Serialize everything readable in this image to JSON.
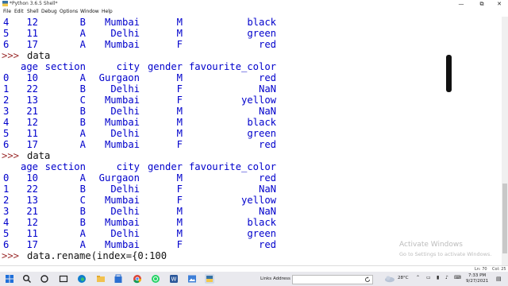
{
  "window": {
    "title": "*Python 3.6.5 Shell*",
    "controls": {
      "minimize": "—",
      "maximize": "⧉",
      "close": "✕"
    }
  },
  "menu": [
    "File",
    "Edit",
    "Shell",
    "Debug",
    "Options",
    "Window",
    "Help"
  ],
  "console": {
    "prompt": ">>>",
    "lines": [
      {
        "kind": "row",
        "cells": [
          "4",
          "12",
          "B",
          "Mumbai",
          "M",
          "black"
        ]
      },
      {
        "kind": "row",
        "cells": [
          "5",
          "11",
          "A",
          "Delhi",
          "M",
          "green"
        ]
      },
      {
        "kind": "row",
        "cells": [
          "6",
          "17",
          "A",
          "Mumbai",
          "F",
          "red"
        ]
      },
      {
        "kind": "cmd",
        "text": "data"
      },
      {
        "kind": "header",
        "cells": [
          "age",
          "section",
          "city",
          "gender",
          "favourite_color"
        ]
      },
      {
        "kind": "row",
        "cells": [
          "0",
          "10",
          "A",
          "Gurgaon",
          "M",
          "red"
        ]
      },
      {
        "kind": "row",
        "cells": [
          "1",
          "22",
          "B",
          "Delhi",
          "F",
          "NaN"
        ]
      },
      {
        "kind": "row",
        "cells": [
          "2",
          "13",
          "C",
          "Mumbai",
          "F",
          "yellow"
        ]
      },
      {
        "kind": "row",
        "cells": [
          "3",
          "21",
          "B",
          "Delhi",
          "M",
          "NaN"
        ]
      },
      {
        "kind": "row",
        "cells": [
          "4",
          "12",
          "B",
          "Mumbai",
          "M",
          "black"
        ]
      },
      {
        "kind": "row",
        "cells": [
          "5",
          "11",
          "A",
          "Delhi",
          "M",
          "green"
        ]
      },
      {
        "kind": "row",
        "cells": [
          "6",
          "17",
          "A",
          "Mumbai",
          "F",
          "red"
        ]
      },
      {
        "kind": "cmd",
        "text": "data"
      },
      {
        "kind": "header",
        "cells": [
          "age",
          "section",
          "city",
          "gender",
          "favourite_color"
        ]
      },
      {
        "kind": "row",
        "cells": [
          "0",
          "10",
          "A",
          "Gurgaon",
          "M",
          "red"
        ]
      },
      {
        "kind": "row",
        "cells": [
          "1",
          "22",
          "B",
          "Delhi",
          "F",
          "NaN"
        ]
      },
      {
        "kind": "row",
        "cells": [
          "2",
          "13",
          "C",
          "Mumbai",
          "F",
          "yellow"
        ]
      },
      {
        "kind": "row",
        "cells": [
          "3",
          "21",
          "B",
          "Delhi",
          "M",
          "NaN"
        ]
      },
      {
        "kind": "row",
        "cells": [
          "4",
          "12",
          "B",
          "Mumbai",
          "M",
          "black"
        ]
      },
      {
        "kind": "row",
        "cells": [
          "5",
          "11",
          "A",
          "Delhi",
          "M",
          "green"
        ]
      },
      {
        "kind": "row",
        "cells": [
          "6",
          "17",
          "A",
          "Mumbai",
          "F",
          "red"
        ]
      },
      {
        "kind": "input",
        "text": "data.rename(index={0:100"
      }
    ]
  },
  "status": {
    "line": "Ln: 70",
    "col": "Col: 25"
  },
  "watermark": {
    "title": "Activate Windows",
    "subtitle": "Go to Settings to activate Windows."
  },
  "taskbar": {
    "links_label": "Links",
    "address_label": "Address",
    "weather": "28°C",
    "time": "7:33 PM",
    "date": "9/27/2021",
    "icons": [
      "windows-start-icon",
      "search-icon",
      "task-view-icon",
      "edge-browser-icon",
      "file-explorer-icon",
      "store-icon",
      "chrome-icon",
      "whatsapp-icon",
      "word-icon",
      "photos-icon",
      "python-idle-icon"
    ]
  },
  "colors": {
    "output": "#0000cc",
    "prompt": "#9b2c2c",
    "text": "#111111"
  }
}
